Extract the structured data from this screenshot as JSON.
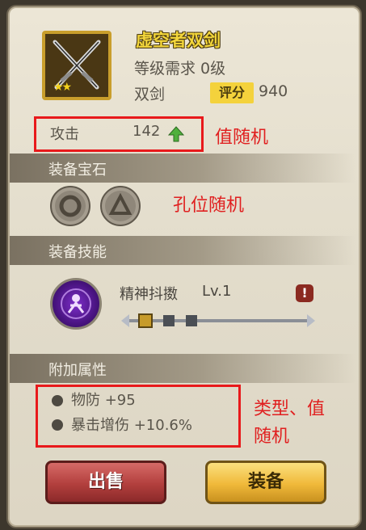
{
  "item": {
    "name": "虚空者双剑",
    "level_requirement": "等级需求 0级",
    "type": "双剑",
    "rating_label": "评分",
    "rating_value": "940",
    "stars": "★★"
  },
  "attack": {
    "label": "攻击",
    "value": "142"
  },
  "sections": {
    "gems": "装备宝石",
    "skills": "装备技能",
    "attributes": "附加属性"
  },
  "skill": {
    "name": "精神抖擞",
    "level": "Lv.1",
    "warning": "!"
  },
  "attributes": [
    {
      "text": "物防 +95"
    },
    {
      "text": "暴击增伤 +10.6%"
    }
  ],
  "annotations": {
    "value_random": "值随机",
    "slot_random": "孔位随机",
    "type_value_random_line1": "类型、值",
    "type_value_random_line2": "随机"
  },
  "buttons": {
    "sell": "出售",
    "equip": "装备"
  },
  "icons": {
    "weapon": "crossed-swords-icon",
    "gem_slot_1": "circle-gem-slot-icon",
    "gem_slot_2": "triangle-gem-slot-icon",
    "skill": "spirit-skill-icon",
    "up_arrow": "up-arrow-icon"
  }
}
